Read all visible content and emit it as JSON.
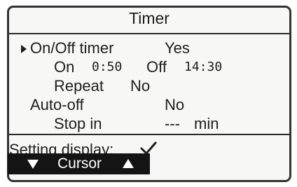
{
  "screen": {
    "title": "Timer",
    "rows": {
      "onoff_timer": {
        "label": "On/Off timer",
        "value": "Yes"
      },
      "on": {
        "label": "On",
        "time": "0:50"
      },
      "off": {
        "label": "Off",
        "time": "14:30"
      },
      "repeat": {
        "label": "Repeat",
        "value": "No"
      },
      "auto_off": {
        "label": "Auto-off",
        "value": "No"
      },
      "stop_in": {
        "label": "Stop in",
        "value": "---",
        "unit": "min"
      }
    }
  },
  "footer": {
    "setting_display": "Setting display:",
    "confirm_icon": "check-icon",
    "cursor_label": "Cursor",
    "cursor_icons": [
      "down-triangle-icon",
      "up-triangle-icon"
    ]
  },
  "colors": {
    "lcd_background": "#f7f7f6",
    "text": "#1e1e1e",
    "highlight_bar": "#141414",
    "frame": "#333333"
  }
}
